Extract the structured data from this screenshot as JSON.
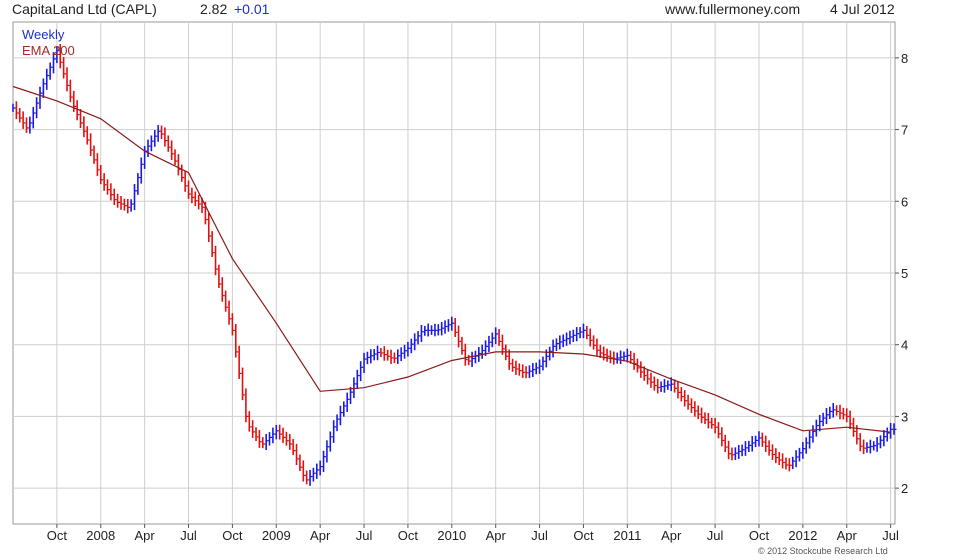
{
  "header": {
    "title": "CapitaLand Ltd (CAPL)",
    "price": "2.82",
    "change": "+0.01",
    "site": "www.fullermoney.com",
    "date": "4 Jul 2012"
  },
  "legend": {
    "period": "Weekly",
    "ema": "EMA 200"
  },
  "copyright": "© 2012 Stockcube Research Ltd",
  "colors": {
    "up": "#1a1ae6",
    "down": "#e01010",
    "ema": "#8b1a1a",
    "grid": "#cfcfcf"
  },
  "chart_data": {
    "type": "line",
    "ylim": [
      1.5,
      8.5
    ],
    "y_ticks": [
      "2",
      "3",
      "4",
      "5",
      "6",
      "7",
      "8"
    ],
    "x_ticks": [
      "Oct",
      "2008",
      "Apr",
      "Jul",
      "Oct",
      "2009",
      "Apr",
      "Jul",
      "Oct",
      "2010",
      "Apr",
      "Jul",
      "Oct",
      "2011",
      "Apr",
      "Jul",
      "Oct",
      "2012",
      "Apr",
      "Jul"
    ],
    "grid": true,
    "series": [
      {
        "name": "EMA 200",
        "x": [
          "2007-07",
          "2007-10",
          "2008-01",
          "2008-04",
          "2008-07",
          "2008-10",
          "2009-01",
          "2009-04",
          "2009-07",
          "2009-10",
          "2010-01",
          "2010-04",
          "2010-07",
          "2010-10",
          "2011-01",
          "2011-04",
          "2011-07",
          "2011-10",
          "2012-01",
          "2012-04",
          "2012-07"
        ],
        "values": [
          7.6,
          7.4,
          7.15,
          6.7,
          6.4,
          5.2,
          4.3,
          3.35,
          3.4,
          3.55,
          3.78,
          3.9,
          3.9,
          3.87,
          3.77,
          3.52,
          3.3,
          3.03,
          2.8,
          2.85,
          2.78
        ]
      },
      {
        "name": "Weekly",
        "x": [
          "2007-07",
          "2007-08",
          "2007-09",
          "2007-10",
          "2007-11",
          "2007-12",
          "2008-01",
          "2008-02",
          "2008-03",
          "2008-04",
          "2008-05",
          "2008-06",
          "2008-07",
          "2008-08",
          "2008-09",
          "2008-10",
          "2008-11",
          "2008-12",
          "2009-01",
          "2009-02",
          "2009-03",
          "2009-04",
          "2009-05",
          "2009-06",
          "2009-07",
          "2009-08",
          "2009-09",
          "2009-10",
          "2009-11",
          "2009-12",
          "2010-01",
          "2010-02",
          "2010-03",
          "2010-04",
          "2010-05",
          "2010-06",
          "2010-07",
          "2010-08",
          "2010-09",
          "2010-10",
          "2010-11",
          "2010-12",
          "2011-01",
          "2011-02",
          "2011-03",
          "2011-04",
          "2011-05",
          "2011-06",
          "2011-07",
          "2011-08",
          "2011-09",
          "2011-10",
          "2011-11",
          "2011-12",
          "2012-01",
          "2012-02",
          "2012-03",
          "2012-04",
          "2012-05",
          "2012-06",
          "2012-07"
        ],
        "values": [
          7.3,
          7.0,
          7.6,
          8.1,
          7.4,
          6.9,
          6.3,
          6.0,
          5.9,
          6.7,
          7.0,
          6.6,
          6.1,
          5.9,
          4.9,
          4.2,
          2.9,
          2.6,
          2.8,
          2.6,
          2.1,
          2.3,
          2.9,
          3.3,
          3.8,
          3.9,
          3.8,
          3.95,
          4.2,
          4.2,
          4.3,
          3.75,
          3.9,
          4.15,
          3.7,
          3.6,
          3.7,
          4.0,
          4.1,
          4.2,
          3.9,
          3.8,
          3.85,
          3.6,
          3.4,
          3.45,
          3.2,
          3.0,
          2.85,
          2.45,
          2.55,
          2.7,
          2.45,
          2.3,
          2.55,
          2.9,
          3.1,
          3.0,
          2.55,
          2.6,
          2.82
        ]
      }
    ]
  }
}
